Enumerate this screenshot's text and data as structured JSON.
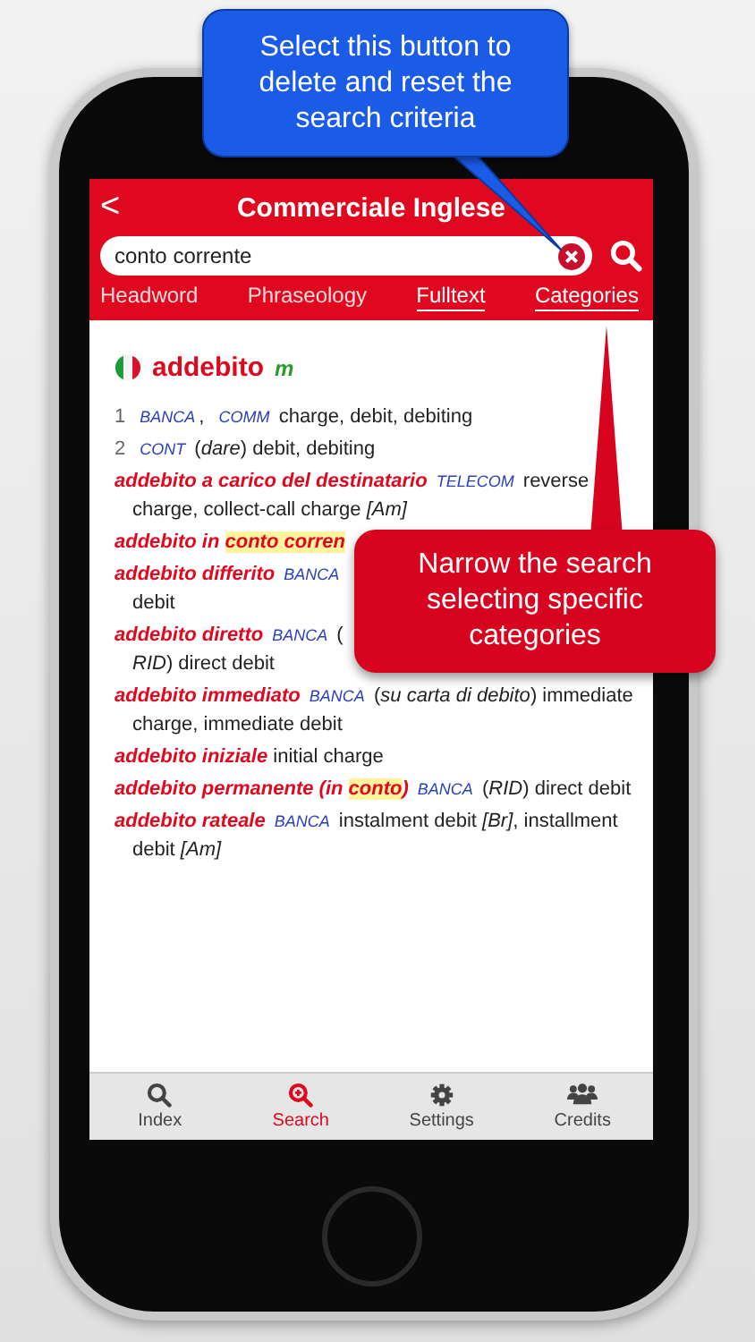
{
  "header": {
    "back": "<",
    "title": "Commerciale Inglese"
  },
  "search": {
    "value": "conto corrente"
  },
  "filters": [
    {
      "label": "Headword",
      "selected": false
    },
    {
      "label": "Phraseology",
      "selected": false
    },
    {
      "label": "Fulltext",
      "selected": true
    },
    {
      "label": "Categories",
      "selected": true
    }
  ],
  "entry": {
    "headword": "addebito",
    "gender": "m"
  },
  "senses": [
    [
      {
        "kind": "num",
        "text": "1"
      },
      {
        "kind": "label",
        "text": "BANCA"
      },
      {
        "kind": "text",
        "text": ", "
      },
      {
        "kind": "label",
        "text": "COMM"
      },
      {
        "kind": "text",
        "text": " charge, debit, debiting"
      }
    ],
    [
      {
        "kind": "num",
        "text": "2"
      },
      {
        "kind": "label",
        "text": "CONT"
      },
      {
        "kind": "text",
        "text": " ("
      },
      {
        "kind": "italic",
        "text": "dare"
      },
      {
        "kind": "text",
        "text": ") debit, debiting"
      }
    ],
    [
      {
        "kind": "head",
        "text": "addebito a carico del destinatario"
      },
      {
        "kind": "label",
        "text": "TELECOM"
      },
      {
        "kind": "text",
        "text": " reverse charge, collect-call charge "
      },
      {
        "kind": "italic",
        "text": "[Am]"
      }
    ],
    [
      {
        "kind": "head",
        "text": "addebito in "
      },
      {
        "kind": "mark",
        "text": "conto"
      },
      {
        "kind": "mark",
        "text": " corren"
      }
    ],
    [
      {
        "kind": "head",
        "text": "addebito differito"
      },
      {
        "kind": "label",
        "text": "BANCA"
      },
      {
        "kind": "break"
      },
      {
        "kind": "text",
        "text": "debit"
      }
    ],
    [
      {
        "kind": "head",
        "text": "addebito diretto"
      },
      {
        "kind": "label",
        "text": "BANCA"
      },
      {
        "kind": "text",
        "text": " ("
      },
      {
        "kind": "break"
      },
      {
        "kind": "italic",
        "text": "RID"
      },
      {
        "kind": "text",
        "text": ") direct debit"
      }
    ],
    [
      {
        "kind": "head",
        "text": "addebito immediato"
      },
      {
        "kind": "label",
        "text": "BANCA"
      },
      {
        "kind": "text",
        "text": " ("
      },
      {
        "kind": "italic",
        "text": "su carta di debito"
      },
      {
        "kind": "text",
        "text": ") immediate charge, immediate debit"
      }
    ],
    [
      {
        "kind": "head",
        "text": "addebito iniziale"
      },
      {
        "kind": "text",
        "text": " initial charge"
      }
    ],
    [
      {
        "kind": "head",
        "text": "addebito permanente (in "
      },
      {
        "kind": "mark",
        "text": "conto"
      },
      {
        "kind": "head",
        "text": ")"
      },
      {
        "kind": "label",
        "text": "BANCA"
      },
      {
        "kind": "text",
        "text": " ("
      },
      {
        "kind": "italic",
        "text": "RID"
      },
      {
        "kind": "text",
        "text": ") direct debit"
      }
    ],
    [
      {
        "kind": "head",
        "text": "addebito rateale"
      },
      {
        "kind": "label",
        "text": "BANCA"
      },
      {
        "kind": "text",
        "text": " instalment debit "
      },
      {
        "kind": "italic",
        "text": "[Br]"
      },
      {
        "kind": "text",
        "text": ", installment debit "
      },
      {
        "kind": "italic",
        "text": "[Am]"
      }
    ]
  ],
  "tab_bar": [
    {
      "label": "Index",
      "selected": false
    },
    {
      "label": "Search",
      "selected": true
    },
    {
      "label": "Settings",
      "selected": false
    },
    {
      "label": "Credits",
      "selected": false
    }
  ],
  "callouts": [
    {
      "kind": "blue",
      "text": "Select this button to delete and reset the search criteria"
    },
    {
      "kind": "red",
      "text": "Narrow the search selecting specific categories"
    }
  ]
}
